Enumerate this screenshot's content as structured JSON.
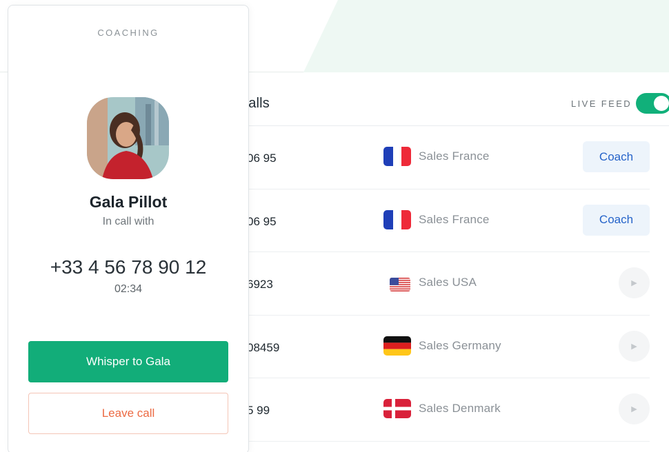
{
  "coaching_card": {
    "label": "COACHING",
    "agent_name": "Gala Pillot",
    "status": "In call with",
    "phone": "+33 4 56 78 90 12",
    "timer": "02:34",
    "whisper_label": "Whisper to Gala",
    "leave_label": "Leave call"
  },
  "calls_panel": {
    "title": "calls",
    "live_feed_label": "LIVE FEED",
    "live_feed_on": true,
    "rows": [
      {
        "number": "06 95",
        "flag": "france",
        "team": "Sales France",
        "action": "Coach"
      },
      {
        "number": "06 95",
        "flag": "france",
        "team": "Sales France",
        "action": "Coach"
      },
      {
        "number": "6923",
        "flag": "usa",
        "team": "Sales USA",
        "action": "play-icon"
      },
      {
        "number": "08459",
        "flag": "germany",
        "team": "Sales Germany",
        "action": "play-icon"
      },
      {
        "number": "5 99",
        "flag": "denmark",
        "team": "Sales Denmark",
        "action": "play-icon"
      }
    ]
  },
  "colors": {
    "accent_green": "#12ad79",
    "coach_blue": "#2563c9",
    "leave_orange": "#ec6a43",
    "band_green": "#eef8f3"
  }
}
